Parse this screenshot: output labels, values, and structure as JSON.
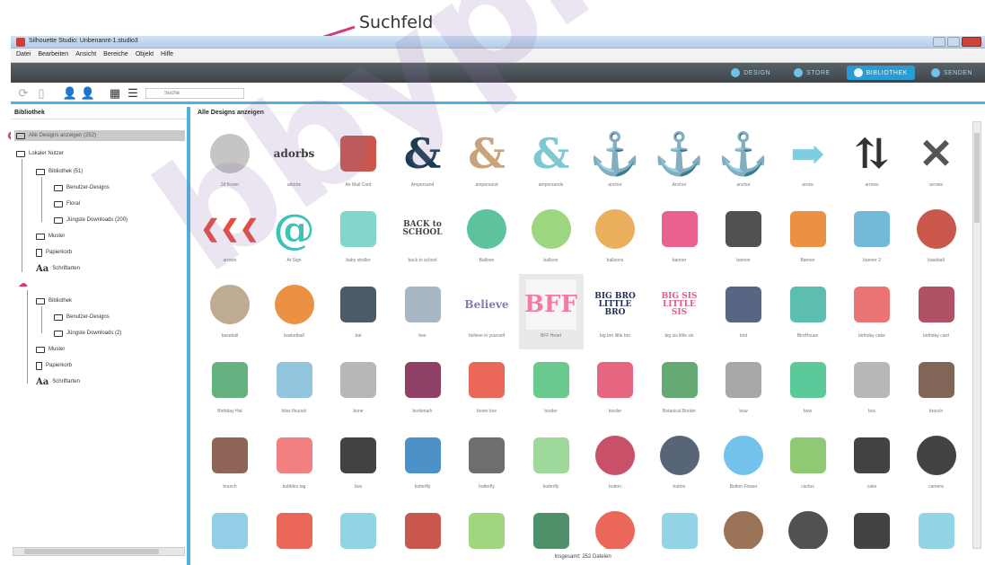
{
  "annotation": {
    "label": "Suchfeld",
    "color": "#d63a7c"
  },
  "window": {
    "title": "Silhouette Studio: Unbenannt-1.studio3"
  },
  "menu": [
    "Datei",
    "Bearbeiten",
    "Ansicht",
    "Bereiche",
    "Objekt",
    "Hilfe"
  ],
  "nav_tabs": [
    {
      "label": "DESIGN",
      "active": false
    },
    {
      "label": "STORE",
      "active": false
    },
    {
      "label": "BIBLIOTHEK",
      "active": true
    },
    {
      "label": "SENDEN",
      "active": false
    }
  ],
  "search": {
    "placeholder": "Suche"
  },
  "sidebar": {
    "title": "Bibliothek",
    "items": [
      {
        "label": "Alle Designs anzeigen (252)"
      },
      {
        "label": "Lokaler Nutzer"
      },
      {
        "label": "Bibliothek (51)"
      },
      {
        "label": "Benutzer-Designs"
      },
      {
        "label": "Floral"
      },
      {
        "label": "Jüngste Downloads (200)"
      },
      {
        "label": "Muster"
      },
      {
        "label": "Papierkorb"
      },
      {
        "label": "Schriftarten"
      },
      {
        "label": "Bibliothek"
      },
      {
        "label": "Benutzer-Designs"
      },
      {
        "label": "Jüngste Downloads (2)"
      },
      {
        "label": "Muster"
      },
      {
        "label": "Papierkorb"
      },
      {
        "label": "Schriftarten"
      }
    ]
  },
  "main": {
    "title": "Alle Designs anzeigen",
    "status": "Insgesamt: 252 Dateien",
    "designs": [
      {
        "label": "3d flower",
        "icon": "flower-icon",
        "color": "#bbbbbb"
      },
      {
        "label": "adorbs",
        "icon": "script-text-icon",
        "color": "#333333",
        "text": "adorbs"
      },
      {
        "label": "Air Mail Card",
        "icon": "envelope-icon",
        "color": "#c0392b"
      },
      {
        "label": "Ampersand",
        "icon": "ampersand-icon",
        "color": "#1b3b4f",
        "text": "&"
      },
      {
        "label": "ampersand",
        "icon": "ampersand-icon",
        "color": "#c9a37b",
        "text": "&"
      },
      {
        "label": "ampersands",
        "icon": "ampersand-icon",
        "color": "#7ec8d3",
        "text": "&"
      },
      {
        "label": "anchor",
        "icon": "anchor-icon",
        "color": "#222222",
        "text": "⚓"
      },
      {
        "label": "Anchor",
        "icon": "anchor-icon",
        "color": "#2c3f7a",
        "text": "⚓"
      },
      {
        "label": "anchor",
        "icon": "anchor-icon",
        "color": "#9a9a9a",
        "text": "⚓"
      },
      {
        "label": "arrow",
        "icon": "arrow-icon",
        "color": "#7fcde0",
        "text": "➡"
      },
      {
        "label": "arrows",
        "icon": "arrows-icon",
        "color": "#333333",
        "text": "⇅"
      },
      {
        "label": "arrows",
        "icon": "arrows-icon",
        "color": "#555555",
        "text": "✕"
      },
      {
        "label": "arrows",
        "icon": "chevrons-icon",
        "color": "#e74c3c",
        "text": "❮❮❮"
      },
      {
        "label": "At Sign",
        "icon": "at-sign-icon",
        "color": "#3ec2b7",
        "text": "@"
      },
      {
        "label": "baby stroller",
        "icon": "stroller-icon",
        "color": "#6ccfc4"
      },
      {
        "label": "back to school",
        "icon": "text-art-icon",
        "color": "#444444",
        "text": "BACK to SCHOOL"
      },
      {
        "label": "Balloon",
        "icon": "balloon-icon",
        "color": "#3fb88c"
      },
      {
        "label": "balloon",
        "icon": "balloon-icon",
        "color": "#8bcf6b"
      },
      {
        "label": "balloons",
        "icon": "balloons-icon",
        "color": "#e8a040"
      },
      {
        "label": "banner",
        "icon": "bunting-icon",
        "color": "#e6457a"
      },
      {
        "label": "banner",
        "icon": "ribbon-banner-icon",
        "color": "#333333"
      },
      {
        "label": "Banner",
        "icon": "banner-icon",
        "color": "#e67e22"
      },
      {
        "label": "banner 2",
        "icon": "ribbon-banner-icon",
        "color": "#5aaed4"
      },
      {
        "label": "baseball",
        "icon": "baseball-icon",
        "color": "#c0392b"
      },
      {
        "label": "baseball",
        "icon": "baseball-icon",
        "color": "#b49c7e"
      },
      {
        "label": "basketball",
        "icon": "basketball-icon",
        "color": "#e67e22"
      },
      {
        "label": "bat",
        "icon": "bat-icon",
        "color": "#2c3e50"
      },
      {
        "label": "bee",
        "icon": "bee-icon",
        "color": "#9ab"
      },
      {
        "label": "believe in yourself",
        "icon": "script-text-icon",
        "color": "#8a7ab0",
        "text": "Believe"
      },
      {
        "label": "BFF Heart",
        "icon": "heart-icon",
        "color": "#f27ba0",
        "text": "BFF"
      },
      {
        "label": "big bro little bro",
        "icon": "text-art-icon",
        "color": "#1e2f5a",
        "text": "BIG BRO LITTLE BRO"
      },
      {
        "label": "big sis little sis",
        "icon": "text-art-icon",
        "color": "#e05a8a",
        "text": "BIG SIS LITTLE SIS"
      },
      {
        "label": "bird",
        "icon": "bird-icon",
        "color": "#3b4b6e"
      },
      {
        "label": "BirdHouse",
        "icon": "birdhouse-icon",
        "color": "#3fb3a0"
      },
      {
        "label": "birthday cake",
        "icon": "cake-icon",
        "color": "#e85d5d"
      },
      {
        "label": "birthday card",
        "icon": "card-icon",
        "color": "#a3324b"
      },
      {
        "label": "Birthday Hat",
        "icon": "party-hat-icon",
        "color": "#4aa56a"
      },
      {
        "label": "bliss flourish",
        "icon": "flourish-icon",
        "color": "#7fbcd6"
      },
      {
        "label": "bone",
        "icon": "bone-icon",
        "color": "#aaaaaa"
      },
      {
        "label": "bookmark",
        "icon": "bookmark-icon",
        "color": "#7a1f4a"
      },
      {
        "label": "boom box",
        "icon": "boombox-icon",
        "color": "#e74c3c"
      },
      {
        "label": "border",
        "icon": "border-icon",
        "color": "#4fbf7a"
      },
      {
        "label": "border",
        "icon": "border-icon",
        "color": "#e24a6b"
      },
      {
        "label": "Botanical Border",
        "icon": "border-icon",
        "color": "#4a9a5a"
      },
      {
        "label": "bow",
        "icon": "bow-icon",
        "color": "#999999"
      },
      {
        "label": "bow",
        "icon": "bow-icon",
        "color": "#3fbf8a"
      },
      {
        "label": "box",
        "icon": "box-icon",
        "color": "#aaaaaa"
      },
      {
        "label": "branch",
        "icon": "branch-icon",
        "color": "#6b4a3a"
      },
      {
        "label": "branch",
        "icon": "branch-icon",
        "color": "#7a4a3a"
      },
      {
        "label": "bubbles tag",
        "icon": "tag-icon",
        "color": "#f06a6a"
      },
      {
        "label": "bus",
        "icon": "bus-icon",
        "color": "#222222"
      },
      {
        "label": "butterfly",
        "icon": "butterfly-icon",
        "color": "#2d7fbf"
      },
      {
        "label": "butterfly",
        "icon": "butterfly-icon",
        "color": "#555555"
      },
      {
        "label": "butterfly",
        "icon": "butterfly-icon",
        "color": "#8ed18a"
      },
      {
        "label": "button",
        "icon": "button-icon",
        "color": "#c0314f"
      },
      {
        "label": "button",
        "icon": "button-icon",
        "color": "#3a4a5e"
      },
      {
        "label": "Button Flower",
        "icon": "flower-icon",
        "color": "#5ab7e8"
      },
      {
        "label": "cactus",
        "icon": "cactus-icon",
        "color": "#7bbf5a"
      },
      {
        "label": "cake",
        "icon": "cake-icon",
        "color": "#222222"
      },
      {
        "label": "camera",
        "icon": "camera-icon",
        "color": "#222222"
      },
      {
        "label": "",
        "icon": "candle-icon",
        "color": "#7fc6e0"
      },
      {
        "label": "",
        "icon": "candy-cane-icon",
        "color": "#e74c3c"
      },
      {
        "label": "",
        "icon": "car-icon",
        "color": "#7fcde0"
      },
      {
        "label": "",
        "icon": "cherry-icon",
        "color": "#c0392b"
      },
      {
        "label": "",
        "icon": "tree-icon",
        "color": "#8fcf6a"
      },
      {
        "label": "",
        "icon": "tree-icon",
        "color": "#2e7d4f"
      },
      {
        "label": "",
        "icon": "circle-icon",
        "color": "#e74c3c"
      },
      {
        "label": "",
        "icon": "line-icon",
        "color": "#7fcde0"
      },
      {
        "label": "",
        "icon": "circle-icon",
        "color": "#8a5a3a"
      },
      {
        "label": "",
        "icon": "circle-icon",
        "color": "#333333"
      },
      {
        "label": "",
        "icon": "cloud-icon",
        "color": "#222222"
      },
      {
        "label": "",
        "icon": "cloud-icon",
        "color": "#7fcde0"
      }
    ]
  }
}
